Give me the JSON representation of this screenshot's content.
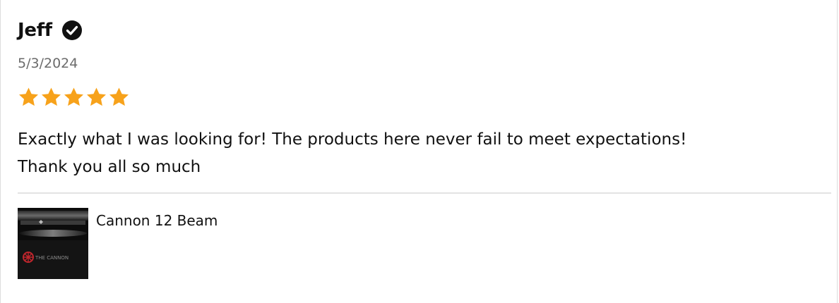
{
  "review": {
    "reviewer_name": "Jeff",
    "verified_icon": "verified-check-icon",
    "date": "5/3/2024",
    "rating": 5,
    "rating_max": 5,
    "star_color": "#F7A21B",
    "body_line1": "Exactly what I was looking for!  The products here never fail to meet expectations!",
    "body_line2": "Thank you all so much"
  },
  "product": {
    "name": "Cannon 12 Beam",
    "thumbnail_text": "THE CANNON"
  }
}
